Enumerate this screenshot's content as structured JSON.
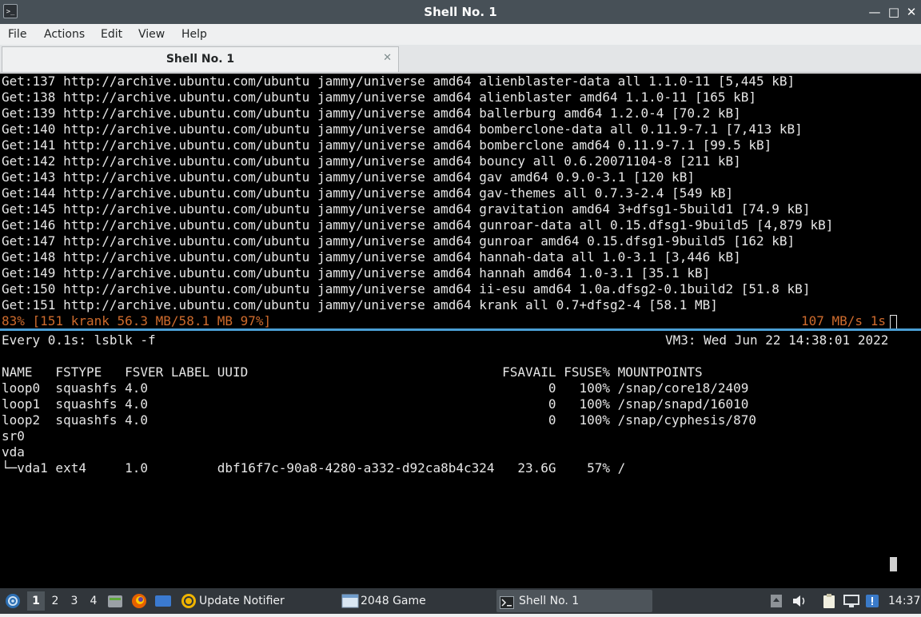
{
  "window": {
    "title": "Shell No. 1",
    "app_icon_glyph": ">_",
    "controls": {
      "minimize": "—",
      "maximize": "□",
      "close": "✕"
    }
  },
  "menu": [
    "File",
    "Actions",
    "Edit",
    "View",
    "Help"
  ],
  "tabs": [
    {
      "label": "Shell No. 1",
      "close": "✕"
    }
  ],
  "top_pane": {
    "lines": [
      "Get:137 http://archive.ubuntu.com/ubuntu jammy/universe amd64 alienblaster-data all 1.1.0-11 [5,445 kB]",
      "Get:138 http://archive.ubuntu.com/ubuntu jammy/universe amd64 alienblaster amd64 1.1.0-11 [165 kB]",
      "Get:139 http://archive.ubuntu.com/ubuntu jammy/universe amd64 ballerburg amd64 1.2.0-4 [70.2 kB]",
      "Get:140 http://archive.ubuntu.com/ubuntu jammy/universe amd64 bomberclone-data all 0.11.9-7.1 [7,413 kB]",
      "Get:141 http://archive.ubuntu.com/ubuntu jammy/universe amd64 bomberclone amd64 0.11.9-7.1 [99.5 kB]",
      "Get:142 http://archive.ubuntu.com/ubuntu jammy/universe amd64 bouncy all 0.6.20071104-8 [211 kB]",
      "Get:143 http://archive.ubuntu.com/ubuntu jammy/universe amd64 gav amd64 0.9.0-3.1 [120 kB]",
      "Get:144 http://archive.ubuntu.com/ubuntu jammy/universe amd64 gav-themes all 0.7.3-2.4 [549 kB]",
      "Get:145 http://archive.ubuntu.com/ubuntu jammy/universe amd64 gravitation amd64 3+dfsg1-5build1 [74.9 kB]",
      "Get:146 http://archive.ubuntu.com/ubuntu jammy/universe amd64 gunroar-data all 0.15.dfsg1-9build5 [4,879 kB]",
      "Get:147 http://archive.ubuntu.com/ubuntu jammy/universe amd64 gunroar amd64 0.15.dfsg1-9build5 [162 kB]",
      "Get:148 http://archive.ubuntu.com/ubuntu jammy/universe amd64 hannah-data all 1.0-3.1 [3,446 kB]",
      "Get:149 http://archive.ubuntu.com/ubuntu jammy/universe amd64 hannah amd64 1.0-3.1 [35.1 kB]",
      "Get:150 http://archive.ubuntu.com/ubuntu jammy/universe amd64 ii-esu amd64 1.0a.dfsg2-0.1build2 [51.8 kB]",
      "Get:151 http://archive.ubuntu.com/ubuntu jammy/universe amd64 krank all 0.7+dfsg2-4 [58.1 MB]"
    ],
    "progress_left": "83% [151 krank 56.3 MB/58.1 MB 97%]",
    "progress_right": "107 MB/s 1s"
  },
  "bottom_pane": {
    "watch_cmd": "Every 0.1s: lsblk -f",
    "watch_status": "VM3: Wed Jun 22 14:38:01 2022",
    "lines": [
      "NAME   FSTYPE   FSVER LABEL UUID                                 FSAVAIL FSUSE% MOUNTPOINTS",
      "loop0  squashfs 4.0                                                    0   100% /snap/core18/2409",
      "loop1  squashfs 4.0                                                    0   100% /snap/snapd/16010",
      "loop2  squashfs 4.0                                                    0   100% /snap/cyphesis/870",
      "sr0",
      "vda",
      "└─vda1 ext4     1.0         dbf16f7c-90a8-4280-a332-d92ca8b4c324   23.6G    57% /"
    ]
  },
  "taskbar": {
    "desktops": [
      "1",
      "2",
      "3",
      "4"
    ],
    "tasks": [
      {
        "label": "Update Notifier",
        "icon": "update-notifier-icon"
      },
      {
        "label": "2048 Game",
        "icon": "game-window-icon"
      },
      {
        "label": "Shell No. 1",
        "icon": "terminal-icon"
      }
    ],
    "clock": "14:37",
    "accent": "#4a9fd5"
  }
}
